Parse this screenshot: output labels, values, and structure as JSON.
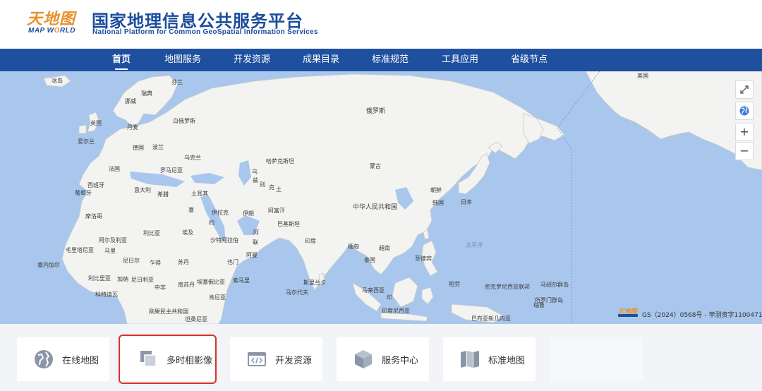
{
  "header": {
    "logo_cn": "天地图",
    "logo_en_a": "MAP W",
    "logo_en_b": "RLD",
    "title": "国家地理信息公共服务平台",
    "subtitle": "National Platform for Common GeoSpatial Information Services"
  },
  "nav": {
    "items": [
      {
        "label": "首页",
        "active": true
      },
      {
        "label": "地图服务"
      },
      {
        "label": "开发资源"
      },
      {
        "label": "成果目录"
      },
      {
        "label": "标准规范"
      },
      {
        "label": "工具应用"
      },
      {
        "label": "省级节点"
      }
    ]
  },
  "map": {
    "labels": [
      "冰岛",
      "芬兰",
      "瑞典",
      "挪威",
      "俄罗斯",
      "英国",
      "丹麦",
      "爱尔兰",
      "德国",
      "波兰",
      "白俄罗斯",
      "乌克兰",
      "法国",
      "罗马尼亚",
      "西班牙",
      "葡萄牙",
      "意大利",
      "希腊",
      "土耳其",
      "哈萨克斯坦",
      "蒙古",
      "乌",
      "兹",
      "别",
      "克",
      "土",
      "朝鲜",
      "韩国",
      "日本",
      "中华人民共和国",
      "伊拉克",
      "伊朗",
      "阿富汗",
      "巴基斯坦",
      "摩洛哥",
      "阿尔及利亚",
      "利比亚",
      "埃及",
      "沙特阿拉伯",
      "阿曼",
      "印度",
      "缅甸",
      "泰国",
      "越南",
      "菲律宾",
      "毛里塔尼亚",
      "马里",
      "尼日尔",
      "乍得",
      "苏丹",
      "也门",
      "塞内加尔",
      "利比里亚",
      "加纳",
      "尼日利亚",
      "中非",
      "南苏丹",
      "科特迪瓦",
      "埃塞俄比亚",
      "刚果民主共和国",
      "坦桑尼亚",
      "肯尼亚",
      "索马里",
      "斯里兰卡",
      "马尔代夫",
      "马来西亚",
      "印度尼西亚",
      "帕劳",
      "密克罗尼西亚联邦",
      "马绍尔群岛",
      "瑙鲁",
      "巴布亚新几内亚",
      "所罗门群岛",
      "美国",
      "太平洋",
      "阿",
      "联",
      "约",
      "塞",
      "印"
    ],
    "copyright": "GS（2024）0568号 - 甲测资字1100471",
    "copyright_logo": "天地图",
    "controls": {
      "fullscreen": "fullscreen-icon",
      "globe": "globe-icon",
      "zoom_in": "+",
      "zoom_out": "−"
    }
  },
  "tiles": [
    {
      "label": "在线地图",
      "icon": "globe-icon"
    },
    {
      "label": "多时相影像",
      "icon": "layers-icon",
      "highlighted": true
    },
    {
      "label": "开发资源",
      "icon": "code-icon"
    },
    {
      "label": "服务中心",
      "icon": "cube-icon"
    },
    {
      "label": "标准地图",
      "icon": "book-icon"
    },
    {
      "label": ""
    }
  ],
  "colors": {
    "brand_blue": "#1f4f9f",
    "logo_orange": "#e8922c",
    "highlight_red": "#d9312a",
    "sea": "#a9c7ec",
    "land": "#f3f3f1"
  }
}
